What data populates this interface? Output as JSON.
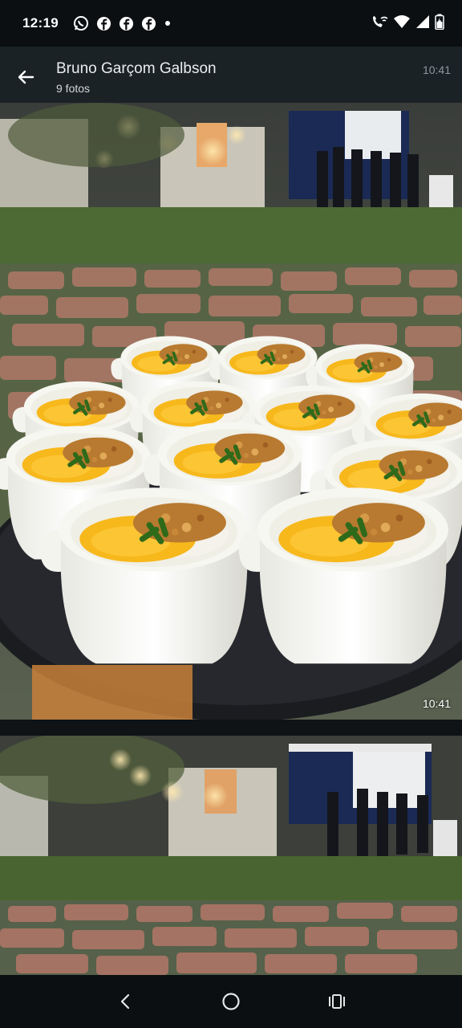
{
  "status_bar": {
    "time": "12:19",
    "notification_icons": [
      "whatsapp-icon",
      "facebook-icon",
      "facebook-icon",
      "facebook-icon",
      "more-dot-icon"
    ],
    "system_icons": [
      "wifi-call-icon",
      "signal-icon",
      "wifi-icon",
      "battery-icon"
    ]
  },
  "header": {
    "title": "Bruno Garçom Galbson",
    "subtitle": "9 fotos",
    "time": "10:41"
  },
  "photos": [
    {
      "time": "10:41",
      "subject": "catering trays of rice with yellow sauce bowls at outdoor garden event"
    },
    {
      "subject": "outdoor garden event at night with stone pathway"
    }
  ],
  "nav_bar": {
    "buttons": [
      "back-icon",
      "home-icon",
      "recents-icon"
    ]
  },
  "colors": {
    "header_bg": "#1b2226",
    "status_bg": "#0b0f12",
    "muted_text": "#8d989e"
  }
}
